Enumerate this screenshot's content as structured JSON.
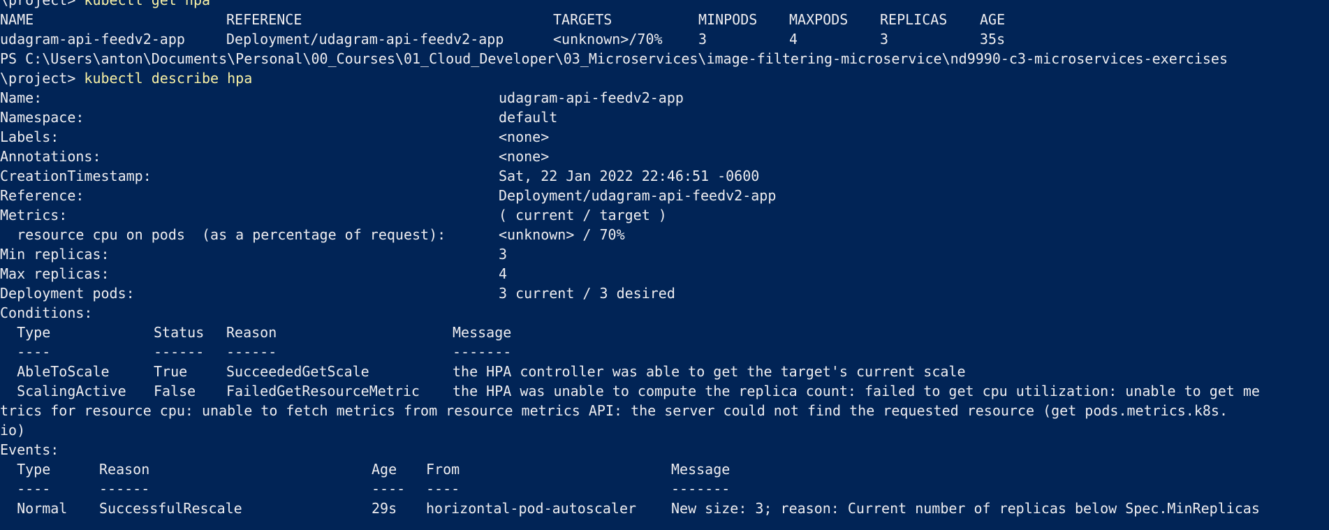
{
  "prompt_cont": "\\project> ",
  "commands": {
    "get": "kubectl get hpa",
    "describe": "kubectl describe hpa"
  },
  "get_table": {
    "headers": [
      "NAME",
      "REFERENCE",
      "TARGETS",
      "MINPODS",
      "MAXPODS",
      "REPLICAS",
      "AGE"
    ],
    "row": [
      "udagram-api-feedv2-app",
      "Deployment/udagram-api-feedv2-app",
      "<unknown>/70%",
      "3",
      "4",
      "3",
      "35s"
    ]
  },
  "ps_path": "PS C:\\Users\\anton\\Documents\\Personal\\00_Courses\\01_Cloud_Developer\\03_Microservices\\image-filtering-microservice\\nd9990-c3-microservices-exercises",
  "describe": {
    "fields": [
      {
        "label": "Name:",
        "value": "udagram-api-feedv2-app"
      },
      {
        "label": "Namespace:",
        "value": "default"
      },
      {
        "label": "Labels:",
        "value": "<none>"
      },
      {
        "label": "Annotations:",
        "value": "<none>"
      },
      {
        "label": "CreationTimestamp:",
        "value": "Sat, 22 Jan 2022 22:46:51 -0600"
      },
      {
        "label": "Reference:",
        "value": "Deployment/udagram-api-feedv2-app"
      },
      {
        "label": "Metrics:",
        "value": "( current / target )"
      },
      {
        "label": "  resource cpu on pods  (as a percentage of request):",
        "value": "<unknown> / 70%"
      },
      {
        "label": "Min replicas:",
        "value": "3"
      },
      {
        "label": "Max replicas:",
        "value": "4"
      },
      {
        "label": "Deployment pods:",
        "value": "3 current / 3 desired"
      }
    ],
    "conditions_label": "Conditions:",
    "conditions_headers": [
      "  Type",
      "Status",
      "Reason",
      "Message"
    ],
    "conditions_dashes": [
      "  ----",
      "------",
      "------",
      "-------"
    ],
    "conditions": [
      {
        "type": "  AbleToScale",
        "status": "True",
        "reason": "SucceededGetScale",
        "message": "the HPA controller was able to get the target's current scale"
      },
      {
        "type": "  ScalingActive",
        "status": "False",
        "reason": "FailedGetResourceMetric",
        "message": "the HPA was unable to compute the replica count: failed to get cpu utilization: unable to get me"
      }
    ],
    "wrap_line_1": "trics for resource cpu: unable to fetch metrics from resource metrics API: the server could not find the requested resource (get pods.metrics.k8s.",
    "wrap_line_2": "io)",
    "events_label": "Events:",
    "events_headers": [
      "  Type",
      "Reason",
      "Age",
      "From",
      "Message"
    ],
    "events_dashes": [
      "  ----",
      "------",
      "----",
      "----",
      "-------"
    ],
    "events": [
      {
        "type": "  Normal",
        "reason": "SuccessfulRescale",
        "age": "29s",
        "from": "horizontal-pod-autoscaler",
        "message": "New size: 3; reason: Current number of replicas below Spec.MinReplicas"
      }
    ]
  }
}
